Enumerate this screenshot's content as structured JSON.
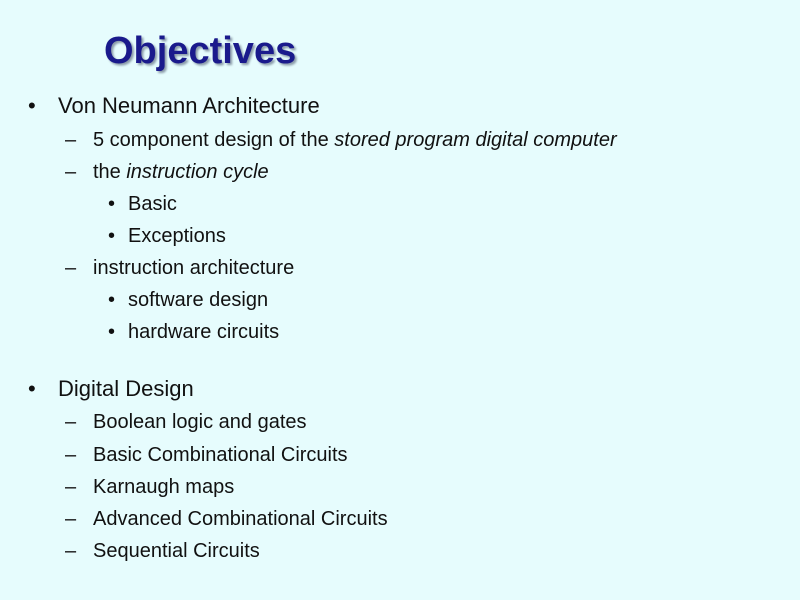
{
  "slide": {
    "title": "Objectives",
    "colors": {
      "background": "#e6fcfd",
      "title": "#1a1a8c",
      "text": "#111111"
    },
    "bullet_glyph": "•",
    "dash_glyph": "–",
    "sections": [
      {
        "heading": "Von Neumann Architecture",
        "items": [
          {
            "prefix": "5 component design of the ",
            "emphasis": "stored program digital computer"
          },
          {
            "prefix": "the ",
            "emphasis": "instruction cycle",
            "subitems": [
              "Basic",
              "Exceptions"
            ]
          },
          {
            "prefix": "instruction architecture",
            "emphasis": "",
            "subitems": [
              "software design",
              "hardware circuits"
            ]
          }
        ]
      },
      {
        "heading": "Digital Design",
        "items": [
          {
            "prefix": "Boolean logic and gates"
          },
          {
            "prefix": "Basic Combinational Circuits"
          },
          {
            "prefix": "Karnaugh maps"
          },
          {
            "prefix": "Advanced Combinational Circuits"
          },
          {
            "prefix": "Sequential Circuits"
          }
        ]
      }
    ]
  }
}
